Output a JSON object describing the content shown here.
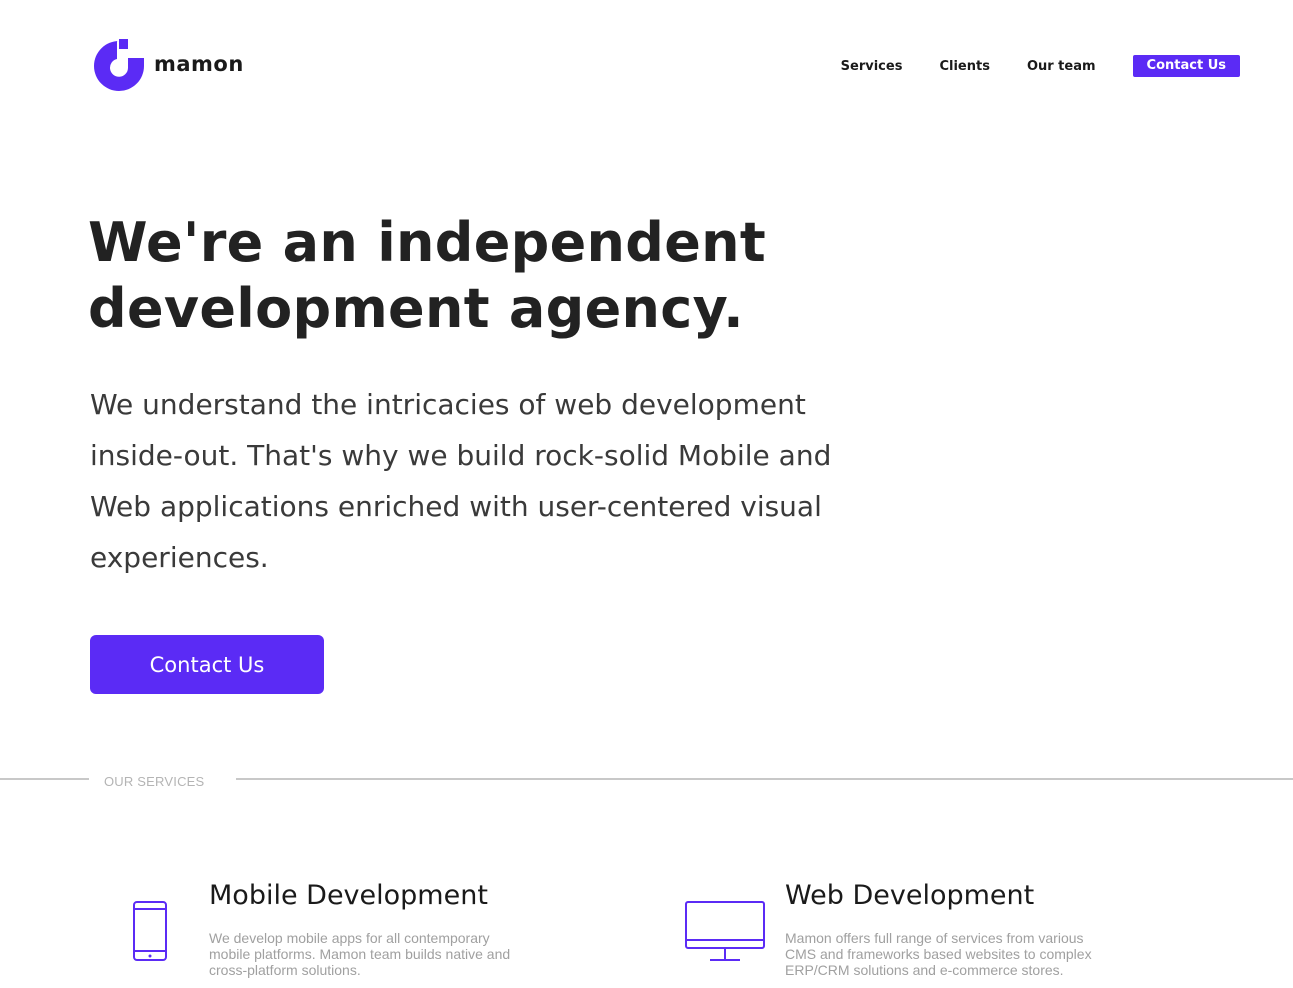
{
  "brand": {
    "name": "mamon",
    "accent": "#5b2bf5",
    "logo_icon": "mamon-logo-icon"
  },
  "nav": {
    "items": [
      "Services",
      "Clients",
      "Our team"
    ],
    "cta": "Contact Us"
  },
  "hero": {
    "title": "We're an independent development agency.",
    "text": "We understand the intricacies of web development inside-out. That's why we build rock-solid Mobile and Web applications enriched with user-centered visual experiences.",
    "button": "Contact Us"
  },
  "section": {
    "label": "OUR SERVICES"
  },
  "services": [
    {
      "icon": "smartphone-icon",
      "title": "Mobile Development",
      "desc": "We develop mobile apps for all contemporary mobile platforms. Mamon team builds native and cross-platform solutions."
    },
    {
      "icon": "desktop-monitor-icon",
      "title": "Web Development",
      "desc": "Mamon offers full range of services from various CMS and frameworks based websites to complex ERP/CRM solutions and e-commerce stores."
    }
  ]
}
